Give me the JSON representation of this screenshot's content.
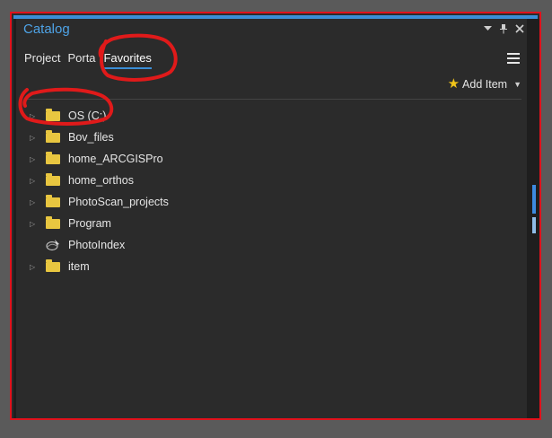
{
  "panel": {
    "title": "Catalog",
    "controls": [
      "chevron-down-icon",
      "pin-icon",
      "close-icon"
    ]
  },
  "tabs": [
    {
      "label": "Project",
      "active": false
    },
    {
      "label": "Portal",
      "active": false
    },
    {
      "label": "Favorites",
      "active": true
    }
  ],
  "toolbar": {
    "add_item_label": "Add Item"
  },
  "tree": [
    {
      "label": "OS (C:)",
      "icon": "folder-icon",
      "expandable": true
    },
    {
      "label": "Bov_files",
      "icon": "folder-icon",
      "expandable": true
    },
    {
      "label": "home_ARCGISPro",
      "icon": "folder-icon",
      "expandable": true
    },
    {
      "label": "home_orthos",
      "icon": "folder-icon",
      "expandable": true
    },
    {
      "label": "PhotoScan_projects",
      "icon": "folder-icon",
      "expandable": true
    },
    {
      "label": "Program",
      "icon": "folder-icon",
      "expandable": true
    },
    {
      "label": "PhotoIndex",
      "icon": "database-icon",
      "expandable": false
    },
    {
      "label": "item",
      "icon": "folder-icon",
      "expandable": true
    }
  ],
  "colors": {
    "accent": "#3b8ed6",
    "frame": "#e0121c",
    "annotation": "#e01a1a",
    "folder": "#e8c640"
  }
}
